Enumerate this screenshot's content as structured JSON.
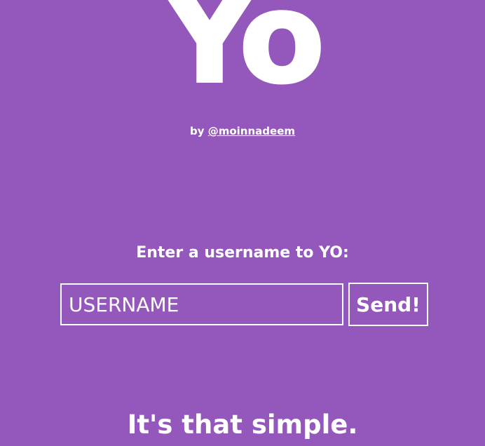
{
  "logo": {
    "text": "Yo"
  },
  "byline": {
    "prefix": "by ",
    "author": "@moinnadeem"
  },
  "form": {
    "prompt": "Enter a username to YO:",
    "username_placeholder": "USERNAME",
    "send_label": "Send!"
  },
  "tagline": "It's that simple.",
  "colors": {
    "background": "#9457bb",
    "foreground": "#ffffff"
  }
}
